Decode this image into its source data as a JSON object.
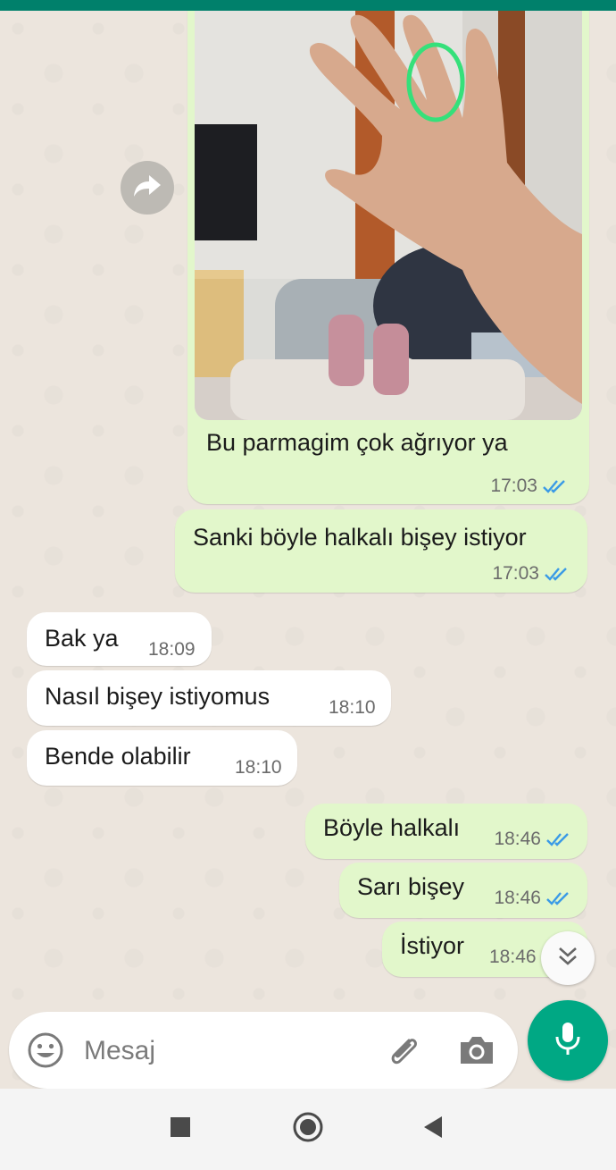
{
  "messages": [
    {
      "id": "m1",
      "direction": "outgoing",
      "type": "image",
      "caption": "Bu parmagim çok ağrıyor ya",
      "time": "17:03",
      "status": "read"
    },
    {
      "id": "m2",
      "direction": "outgoing",
      "text": "Sanki böyle halkalı bişey istiyor",
      "time": "17:03",
      "status": "read"
    },
    {
      "id": "m3",
      "direction": "incoming",
      "text": "Bak ya",
      "time": "18:09"
    },
    {
      "id": "m4",
      "direction": "incoming",
      "text": "Nasıl bişey istiyomus",
      "time": "18:10"
    },
    {
      "id": "m5",
      "direction": "incoming",
      "text": "Bende olabilir",
      "time": "18:10"
    },
    {
      "id": "m6",
      "direction": "outgoing",
      "text": "Böyle halkalı",
      "time": "18:46",
      "status": "read"
    },
    {
      "id": "m7",
      "direction": "outgoing",
      "text": "Sarı bişey",
      "time": "18:46",
      "status": "read"
    },
    {
      "id": "m8",
      "direction": "outgoing",
      "text": "İstiyor",
      "time": "18:46",
      "status": "read"
    }
  ],
  "composer": {
    "placeholder": "Mesaj"
  },
  "icons": {
    "share": "forward-arrow-icon",
    "scroll": "double-chevron-down-icon",
    "emoji": "emoji-icon",
    "attach": "paperclip-icon",
    "camera": "camera-icon",
    "mic": "microphone-icon"
  },
  "colors": {
    "header": "#00806b",
    "outgoing_bubble": "#e2f7cb",
    "incoming_bubble": "#ffffff",
    "chat_background": "#ece5dd",
    "read_ticks": "#3a9ae6",
    "mic_button": "#00a884"
  }
}
